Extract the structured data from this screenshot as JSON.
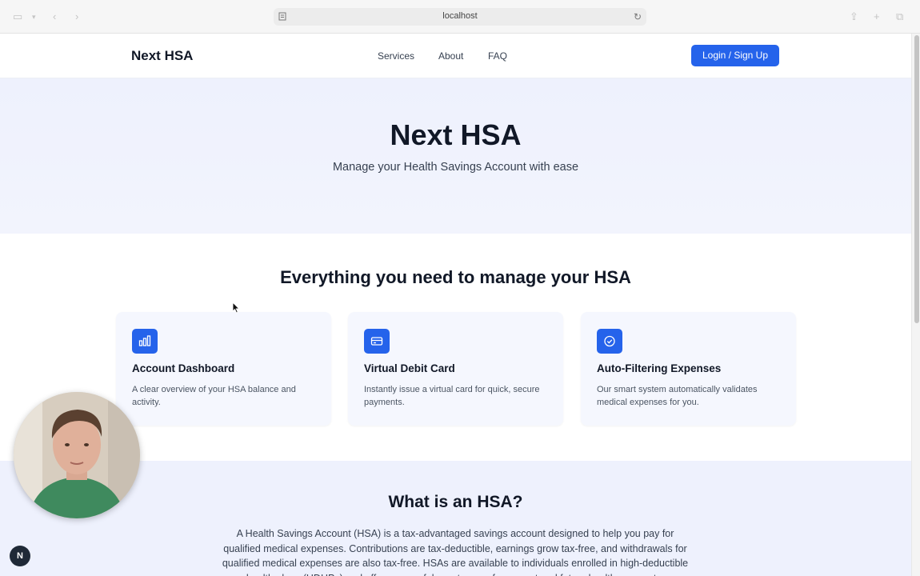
{
  "browser": {
    "address": "localhost"
  },
  "nav": {
    "brand": "Next HSA",
    "links": [
      "Services",
      "About",
      "FAQ"
    ],
    "login_label": "Login / Sign Up"
  },
  "hero": {
    "title": "Next HSA",
    "subtitle": "Manage your Health Savings Account with ease"
  },
  "features": {
    "title": "Everything you need to manage your HSA",
    "cards": [
      {
        "icon": "bar-chart-icon",
        "title": "Account Dashboard",
        "description": "A clear overview of your HSA balance and activity."
      },
      {
        "icon": "credit-card-icon",
        "title": "Virtual Debit Card",
        "description": "Instantly issue a virtual card for quick, secure payments."
      },
      {
        "icon": "check-circle-icon",
        "title": "Auto-Filtering Expenses",
        "description": "Our smart system automatically validates medical expenses for you."
      }
    ]
  },
  "about": {
    "title": "What is an HSA?",
    "body": "A Health Savings Account (HSA) is a tax-advantaged savings account designed to help you pay for qualified medical expenses. Contributions are tax-deductible, earnings grow tax-free, and withdrawals for qualified medical expenses are also tax-free. HSAs are available to individuals enrolled in high-deductible health plans (HDHPs) and offer a powerful way to save for current and future healthcare costs."
  },
  "overlay": {
    "badge": "N"
  },
  "colors": {
    "accent": "#2563eb",
    "hero_bg": "#eef1fd",
    "card_bg": "#f5f7fe"
  }
}
